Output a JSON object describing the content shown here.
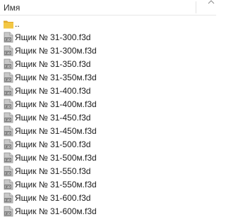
{
  "header": {
    "name_column": "Имя"
  },
  "parent_folder": {
    "label": ".."
  },
  "files": [
    {
      "name": "Ящик № 31-300.f3d"
    },
    {
      "name": "Ящик № 31-300м.f3d"
    },
    {
      "name": "Ящик № 31-350.f3d"
    },
    {
      "name": "Ящик № 31-350м.f3d"
    },
    {
      "name": "Ящик № 31-400.f3d"
    },
    {
      "name": "Ящик № 31-400м.f3d"
    },
    {
      "name": "Ящик № 31-450.f3d"
    },
    {
      "name": "Ящик № 31-450м.f3d"
    },
    {
      "name": "Ящик № 31-500.f3d"
    },
    {
      "name": "Ящик № 31-500м.f3d"
    },
    {
      "name": "Ящик № 31-550.f3d"
    },
    {
      "name": "Ящик № 31-550м.f3d"
    },
    {
      "name": "Ящик № 31-600.f3d"
    },
    {
      "name": "Ящик № 31-600м.f3d"
    }
  ],
  "icons": {
    "folder": "folder-icon",
    "file": "f3d-file-icon",
    "sort": "chevron-up-icon"
  },
  "colors": {
    "folder_body": "#F3C744",
    "folder_tab": "#E0A92B",
    "file_body": "#B8B8B8",
    "file_dark": "#6E6E6E"
  }
}
